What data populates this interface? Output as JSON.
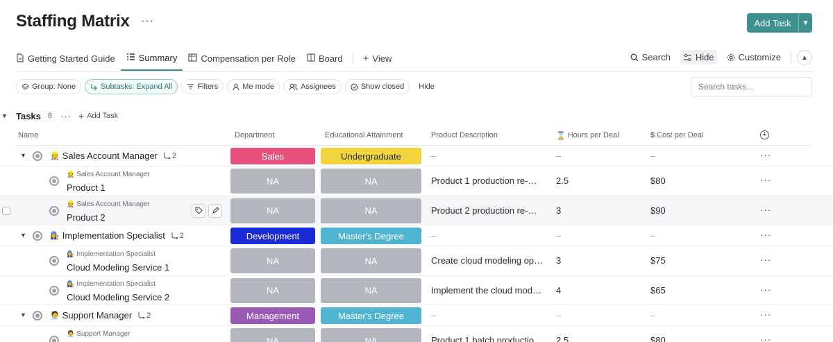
{
  "page": {
    "title": "Staffing Matrix",
    "more_icon": "ellipsis-icon",
    "add_task_label": "Add Task"
  },
  "tabs": [
    {
      "label": "Getting Started Guide",
      "icon": "doc-icon"
    },
    {
      "label": "Summary",
      "icon": "list-icon",
      "active": true
    },
    {
      "label": "Compensation per Role",
      "icon": "table-icon"
    },
    {
      "label": "Board",
      "icon": "board-icon"
    },
    {
      "label": "View",
      "icon": "plus-icon"
    }
  ],
  "toolbar": {
    "search_label": "Search",
    "hide_label": "Hide",
    "customize_label": "Customize"
  },
  "filters": {
    "group": "Group: None",
    "subtasks": "Subtasks: Expand All",
    "filters": "Filters",
    "me_mode": "Me mode",
    "assignees": "Assignees",
    "show_closed": "Show closed",
    "hide": "Hide",
    "search_placeholder": "Search tasks..."
  },
  "group": {
    "name": "Tasks",
    "count": "8",
    "add_task": "Add Task"
  },
  "columns": {
    "name": "Name",
    "department": "Department",
    "education": "Educational Attainment",
    "description": "Product Description",
    "hours": "Hours per Deal",
    "cost": "Cost per Deal"
  },
  "colors": {
    "accent": "#3e8f8f",
    "sales": "#e8517b",
    "development": "#1b2bd6",
    "management": "#9b59b6",
    "undergraduate": "#f2d43d",
    "masters": "#4fb4cf",
    "na": "#b3b6bc"
  },
  "rows": [
    {
      "type": "parent",
      "emoji": "👷",
      "name": "Sales Account Manager",
      "subtasks": "2",
      "department": "Sales",
      "education": "Undergraduate",
      "description": "–",
      "hours": "–",
      "cost": "–"
    },
    {
      "type": "child",
      "parent": "Sales Account Manager",
      "emoji": "👷",
      "name": "Product 1",
      "department": "NA",
      "education": "NA",
      "description": "Product 1 production re-…",
      "hours": "2.5",
      "cost": "$80"
    },
    {
      "type": "child",
      "parent": "Sales Account Manager",
      "emoji": "👷",
      "name": "Product 2",
      "department": "NA",
      "education": "NA",
      "description": "Product 2 production re-…",
      "hours": "3",
      "cost": "$90",
      "hover": true
    },
    {
      "type": "parent",
      "emoji": "👩‍🔧",
      "name": "Implementation Specialist",
      "subtasks": "2",
      "department": "Development",
      "education": "Master's Degree",
      "description": "–",
      "hours": "–",
      "cost": "–"
    },
    {
      "type": "child",
      "parent": "Implementation Specialist",
      "emoji": "👩‍🔧",
      "name": "Cloud Modeling Service 1",
      "department": "NA",
      "education": "NA",
      "description": "Create cloud modeling op…",
      "hours": "3",
      "cost": "$75"
    },
    {
      "type": "child",
      "parent": "Implementation Specialist",
      "emoji": "👩‍🔧",
      "name": "Cloud Modeling Service 2",
      "department": "NA",
      "education": "NA",
      "description": "Implement the cloud mod…",
      "hours": "4",
      "cost": "$65"
    },
    {
      "type": "parent",
      "emoji": "🧑‍💼",
      "name": "Support Manager",
      "subtasks": "2",
      "department": "Management",
      "education": "Master's Degree",
      "description": "–",
      "hours": "–",
      "cost": "–"
    },
    {
      "type": "child",
      "parent": "Support Manager",
      "emoji": "🧑‍💼",
      "name": "",
      "department": "NA",
      "education": "NA",
      "description": "Product 1 batch productio…",
      "hours": "2.5",
      "cost": "$80"
    }
  ]
}
